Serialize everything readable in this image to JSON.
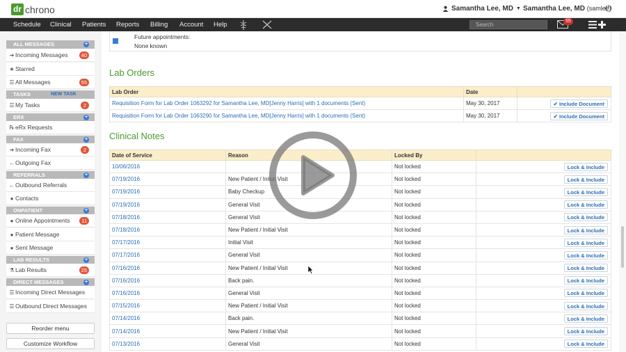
{
  "header": {
    "logo_dr": "dr",
    "logo_chrono": "chrono",
    "user_menu": "Samantha Lee, MD",
    "user_name": "Samantha Lee, MD",
    "username": "(samlee)",
    "search_placeholder": "Search",
    "mail_count": "55"
  },
  "nav": [
    "Schedule",
    "Clinical",
    "Patients",
    "Reports",
    "Billing",
    "Account",
    "Help"
  ],
  "sidebar": {
    "sections": [
      {
        "title": "ALL MESSAGES",
        "items": [
          {
            "label": "Incoming Messages",
            "icon": "arrow-right-icon",
            "badge": "40"
          },
          {
            "label": "Starred",
            "icon": "star-icon",
            "badge": ""
          },
          {
            "label": "All Messages",
            "icon": "list-icon",
            "badge": "55"
          }
        ]
      },
      {
        "title": "TASKS",
        "extra": "NEW TASK",
        "items": [
          {
            "label": "My Tasks",
            "icon": "list-icon",
            "badge": "2"
          }
        ]
      },
      {
        "title": "ERX",
        "items": [
          {
            "label": "eRx Requests",
            "icon": "rx-icon",
            "badge": ""
          }
        ]
      },
      {
        "title": "FAX",
        "items": [
          {
            "label": "Incoming Fax",
            "icon": "arrow-right-icon",
            "badge": "2"
          },
          {
            "label": "Outgoing Fax",
            "icon": "arrow-left-icon",
            "badge": ""
          }
        ]
      },
      {
        "title": "REFERRALS",
        "items": [
          {
            "label": "Outbound Referrals",
            "icon": "arrow-left-icon",
            "badge": ""
          },
          {
            "label": "Contacts",
            "icon": "user-icon",
            "badge": ""
          }
        ]
      },
      {
        "title": "ONPATIENT",
        "items": [
          {
            "label": "Online Appointments",
            "icon": "circle-icon",
            "badge": "11"
          },
          {
            "label": "Patient Message",
            "icon": "circle-icon",
            "badge": ""
          },
          {
            "label": "Sent Message",
            "icon": "circle-icon",
            "badge": ""
          }
        ]
      },
      {
        "title": "LAB RESULTS",
        "items": [
          {
            "label": "Lab Results",
            "icon": "flask-icon",
            "badge": "25"
          }
        ]
      },
      {
        "title": "DIRECT MESSAGES",
        "items": [
          {
            "label": "Incoming Direct Messages",
            "icon": "list-icon",
            "badge": ""
          },
          {
            "label": "Outbound Direct Messages",
            "icon": "list-icon",
            "badge": ""
          }
        ]
      }
    ],
    "reorder_label": "Reorder menu",
    "customize_label": "Customize Workflow"
  },
  "future": {
    "label": "Future appointments:",
    "value": "None known"
  },
  "lab_orders": {
    "title": "Lab Orders",
    "headers": [
      "Lab Order",
      "Date",
      ""
    ],
    "rows": [
      {
        "order": "Requisition Form for Lab Order 1063292 for Samantha Lee, MD[Jenny Harris] with 1 documents (Sent)",
        "date": "May 30, 2017",
        "action": "Include Document"
      },
      {
        "order": "Requisition Form for Lab Order 1063290 for Samantha Lee, MD[Jenny Harris] with 1 documents (Sent)",
        "date": "May 30, 2017",
        "action": "Include Document"
      }
    ]
  },
  "clinical_notes": {
    "title": "Clinical Notes",
    "headers": [
      "Date of Service",
      "Reason",
      "Locked By",
      ""
    ],
    "action_label": "Lock & Include",
    "rows": [
      {
        "date": "10/06/2016",
        "reason": "",
        "locked": "Not locked"
      },
      {
        "date": "07/19/2016",
        "reason": "New Patient / Initial Visit",
        "locked": "Not locked"
      },
      {
        "date": "07/19/2016",
        "reason": "Baby Checkup",
        "locked": "Not locked"
      },
      {
        "date": "07/19/2016",
        "reason": "General Visit",
        "locked": "Not locked"
      },
      {
        "date": "07/18/2016",
        "reason": "General Visit",
        "locked": "Not locked"
      },
      {
        "date": "07/18/2016",
        "reason": "New Patient / Initial Visit",
        "locked": "Not locked"
      },
      {
        "date": "07/17/2016",
        "reason": "Initial Visit",
        "locked": "Not locked"
      },
      {
        "date": "07/17/2016",
        "reason": "General Visit",
        "locked": "Not locked"
      },
      {
        "date": "07/16/2016",
        "reason": "New Patient / Initial Visit",
        "locked": "Not locked"
      },
      {
        "date": "07/16/2016",
        "reason": "Back pain.",
        "locked": "Not locked"
      },
      {
        "date": "07/16/2016",
        "reason": "General Visit",
        "locked": "Not locked"
      },
      {
        "date": "07/15/2016",
        "reason": "New Patient / Initial Visit",
        "locked": "Not locked"
      },
      {
        "date": "07/14/2016",
        "reason": "Back pain.",
        "locked": "Not locked"
      },
      {
        "date": "07/14/2016",
        "reason": "New Patient / Initial Visit",
        "locked": "Not locked"
      },
      {
        "date": "07/13/2016",
        "reason": "General Visit",
        "locked": "Not locked"
      }
    ]
  },
  "colors": {
    "brand_green": "#4a9b2c",
    "nav_bg": "#2c2c2c",
    "badge_red": "#e0573a",
    "link_blue": "#2a6db5",
    "table_header": "#fbeecb"
  }
}
